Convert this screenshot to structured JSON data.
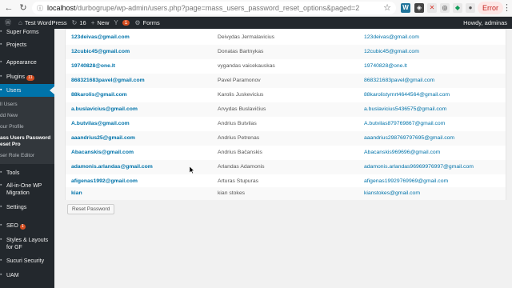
{
  "browser": {
    "url_host": "localhost",
    "url_path": "/durbogrupe/wp-admin/users.php?page=mass_users_password_reset_options&paged=2",
    "error_label": "Error"
  },
  "adminbar": {
    "site_name": "Test WordPress",
    "updates_count": "16",
    "new_label": "New",
    "comments_count": "1",
    "forms_label": "Forms",
    "howdy": "Howdy, adminas"
  },
  "sidebar": {
    "items": [
      {
        "label": "Super Forms"
      },
      {
        "label": "Projects"
      },
      {
        "label": "Appearance"
      },
      {
        "label": "Plugins",
        "badge": "11"
      },
      {
        "label": "Users"
      },
      {
        "label": "Tools"
      },
      {
        "label": "All-in-One WP Migration"
      },
      {
        "label": "Settings"
      },
      {
        "label": "SEO",
        "badge": "1"
      },
      {
        "label": "Styles & Layouts for GF"
      },
      {
        "label": "Sucuri Security"
      },
      {
        "label": "UAM"
      }
    ],
    "users_submenu": [
      {
        "label": "ll Users"
      },
      {
        "label": "dd New"
      },
      {
        "label": "our Profile"
      },
      {
        "label": "ass Users Password"
      },
      {
        "label": "eset Pro"
      },
      {
        "label": "ser Role Editor"
      }
    ]
  },
  "table": {
    "rows": [
      {
        "username": "123deivas@gmail.com",
        "name": "Deivydas Jermalavicius",
        "email": "123deivas@gmail.com"
      },
      {
        "username": "12cubic45@gmail.com",
        "name": "Donatas Bartnykas",
        "email": "12cubic45@gmail.com"
      },
      {
        "username": "19740828@one.lt",
        "name": "vygandas vaicekauskas",
        "email": "19740828@one.lt"
      },
      {
        "username": "868321683pavel@gmail.com",
        "name": "Pavel Paramonov",
        "email": "868321683pavel@gmail.com"
      },
      {
        "username": "88karolis@gmail.com",
        "name": "Karolis Juskevicius",
        "email": "88karolistyrnrt4644564@gmail.com"
      },
      {
        "username": "a.buslavicius@gmail.com",
        "name": "Arvydas Buslavičius",
        "email": "a.buslavicius5436575@gmail.com"
      },
      {
        "username": "A.butvilas@gmail.com",
        "name": "Andrius Butvilas",
        "email": "A.butvilas879769867@gmail.com"
      },
      {
        "username": "aaandrius25@gmail.com",
        "name": "Andrius Petrenas",
        "email": "aaandrius298769797695@gmail.com"
      },
      {
        "username": "Abacanskis@gmail.com",
        "name": "Andrius Bačanskis",
        "email": "Abacanskis969696@gmail.com"
      },
      {
        "username": "adamonis.arlandas@gmail.com",
        "name": "Arlandas Adamonis",
        "email": "adamonis.arlandas96969976997@gmail.com"
      },
      {
        "username": "afigenas1992@gmail.com",
        "name": "Arturas Stupuras",
        "email": "afigenas19929769969@gmail.com"
      },
      {
        "username": "kian",
        "name": "kian stokes",
        "email": "kianstokes@gmail.com"
      }
    ]
  },
  "reset_button": "Reset Password",
  "colors": {
    "admin_dark": "#23282d",
    "link_blue": "#0073aa",
    "badge_orange": "#d54e21"
  }
}
